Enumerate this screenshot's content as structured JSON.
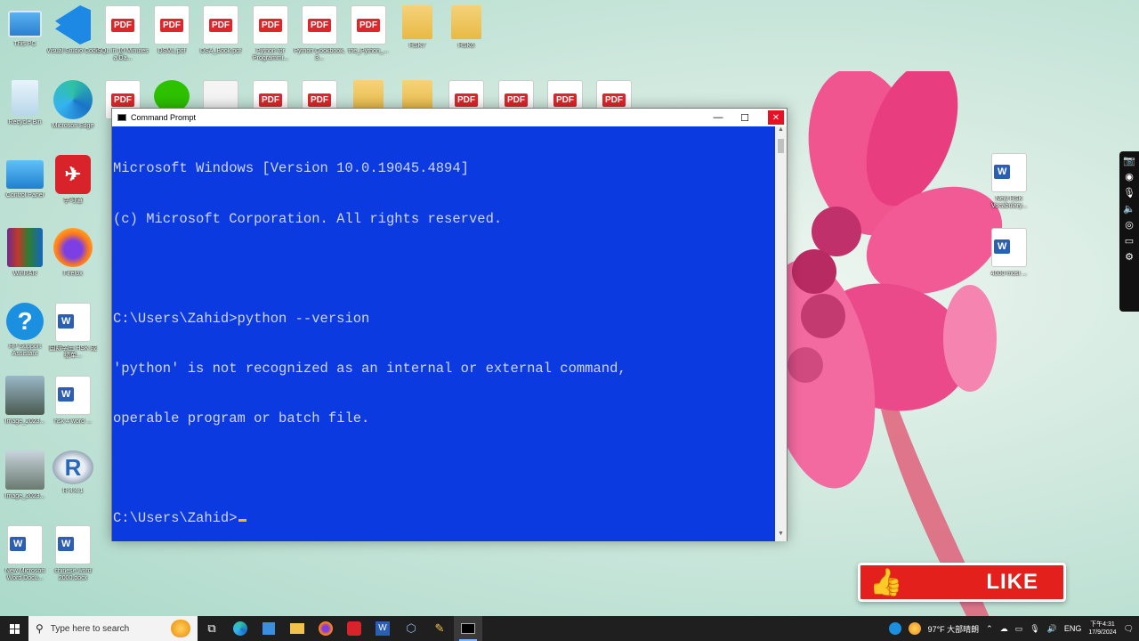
{
  "desktop_icons": [
    {
      "label": "This PC",
      "kind": "pc"
    },
    {
      "label": "Visual Studio Code",
      "kind": "vscode"
    },
    {
      "label": "SQL in 10 Minutes a Da...",
      "kind": "pdf"
    },
    {
      "label": "DSML.pdf",
      "kind": "pdf"
    },
    {
      "label": "DSA_Book.pdf",
      "kind": "pdf"
    },
    {
      "label": "Python for Programmi...",
      "kind": "pdf"
    },
    {
      "label": "Python Cookbook, 3...",
      "kind": "pdf"
    },
    {
      "label": "the_Python_...",
      "kind": "pdf"
    },
    {
      "label": "HSK7",
      "kind": "folder"
    },
    {
      "label": "HSK6",
      "kind": "folder"
    },
    {
      "label": "Recycle Bin",
      "kind": "recycle"
    },
    {
      "label": "Microsoft Edge",
      "kind": "edge"
    },
    {
      "label": "Control Panel",
      "kind": "control"
    },
    {
      "label": "学习通",
      "kind": "app-red"
    },
    {
      "label": "WinRAR",
      "kind": "winrar"
    },
    {
      "label": "Firefox",
      "kind": "firefox"
    },
    {
      "label": "HP Support Assistant",
      "kind": "hp"
    },
    {
      "label": "国际学生 HSK 成绩单...",
      "kind": "word"
    },
    {
      "label": "Image_2023...",
      "kind": "photo"
    },
    {
      "label": "hsk 4 word ...",
      "kind": "word"
    },
    {
      "label": "Image_2023...",
      "kind": "photo"
    },
    {
      "label": "R 4.4.1",
      "kind": "r"
    },
    {
      "label": "New Microsoft Word Docu...",
      "kind": "word"
    },
    {
      "label": "chinese word 2000.docx",
      "kind": "word"
    },
    {
      "label": "New HSK Vocabulary...",
      "kind": "word"
    },
    {
      "label": "4000 most ...",
      "kind": "word"
    }
  ],
  "cmd": {
    "title": "Command Prompt",
    "minimize": "—",
    "maximize": "☐",
    "close": "✕",
    "lines": [
      "Microsoft Windows [Version 10.0.19045.4894]",
      "(c) Microsoft Corporation. All rights reserved.",
      "",
      "C:\\Users\\Zahid>python --version",
      "'python' is not recognized as an internal or external command,",
      "operable program or batch file.",
      "",
      "C:\\Users\\Zahid>"
    ]
  },
  "like": {
    "label": "LIKE"
  },
  "taskbar": {
    "search_placeholder": "Type here to search",
    "weather": "97°F 大部晴朗",
    "lang": "ENG",
    "time": "下午4:31",
    "date": "17/9/2024"
  },
  "colors": {
    "console_bg": "#0a3ae0",
    "like_red": "#e3201b",
    "taskbar": "#1f1f1f"
  }
}
